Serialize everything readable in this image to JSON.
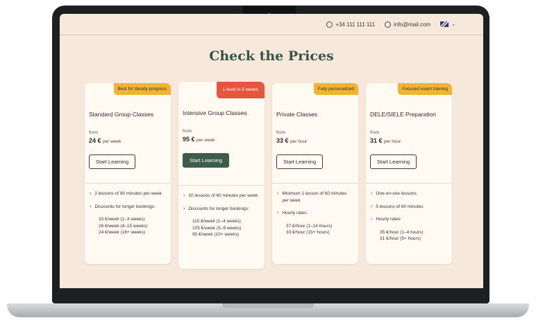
{
  "topbar": {
    "phone": "+34 111 111 111",
    "email": "info@mail.com",
    "language_flag_icon": "uk-flag-icon"
  },
  "page_title": "Check the Prices",
  "cards": [
    {
      "badge": "Best for steady progress",
      "badge_color": "#f0b432",
      "name": "Standard Group Classes",
      "from": "from",
      "price": "24 €",
      "per": "per week",
      "button": "Start Learning",
      "feature1": "2 lessons of 90 minutes per week",
      "feature2": "Discounts for longer bookings:",
      "sub": [
        "33 €/week (1–3 weeks)",
        "26 €/week (4–15 weeks)",
        "24 €/week (16+ weeks)"
      ]
    },
    {
      "badge": "1 level in 8 weeks",
      "badge_color": "#e4573d",
      "name": "Intensive Group Classes",
      "from": "from",
      "price": "95 €",
      "per": "per week",
      "button": "Start Learning",
      "feature1": "10 lessons of 60 minutes per week",
      "feature2": "Discounts for longer bookings:",
      "sub": [
        "115 €/week (1–4 weeks)",
        "105 €/week (5–9 weeks)",
        "95 €/week (10+ weeks)"
      ]
    },
    {
      "badge": "Fully personalized",
      "badge_color": "#f0b432",
      "name": "Private Classes",
      "from": "from",
      "price": "33 €",
      "per": "per hour",
      "button": "Start Learning",
      "feature1": "Minimum 1 lesson of 60 minutes per week",
      "feature2": "Hourly rates:",
      "sub": [
        "37 €/hour (1–14 hours)",
        "33 €/hour (15+ hours)"
      ]
    },
    {
      "badge": "Focused exam training",
      "badge_color": "#f0b432",
      "name": "DELE/SIELE Preparation",
      "from": "from",
      "price": "31 €",
      "per": "per hour",
      "button": "Start Learning",
      "feature1": "One-on-one lessons",
      "feature2": "5 lessons of 60 minutes",
      "feature3": "Hourly rates:",
      "sub": [
        "35 €/hour (1–4 hours)",
        "31 €/hour (5+ hours)"
      ]
    }
  ]
}
